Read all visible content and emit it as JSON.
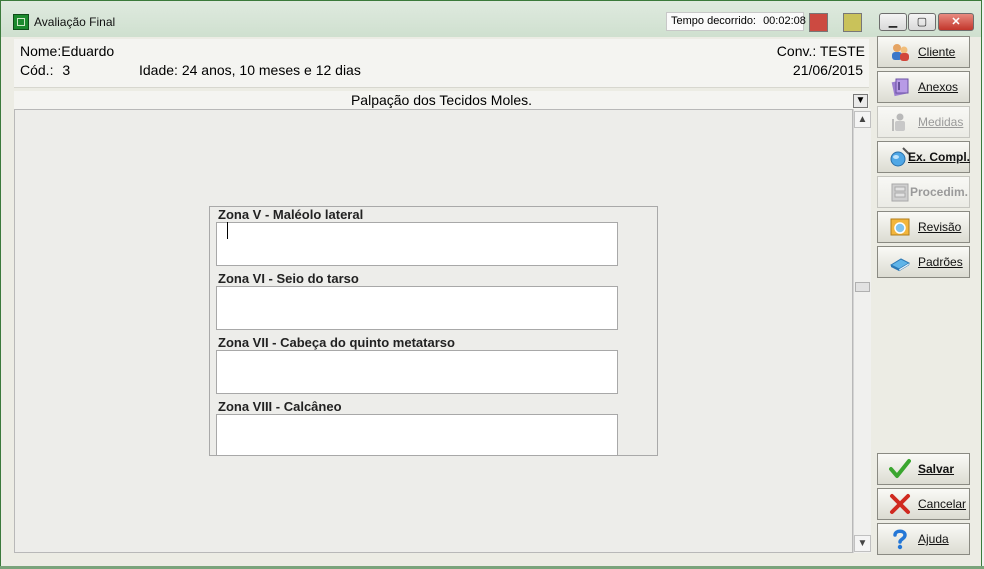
{
  "window": {
    "title": "Avaliação Final"
  },
  "timer": {
    "label": "Tempo decorrido:",
    "value": "00:02:08"
  },
  "window_controls": {
    "minimize": "▁",
    "maximize": "▢",
    "close": "✕"
  },
  "patient": {
    "name_label": "Nome:",
    "name": "Eduardo",
    "code_label": "Cód.:",
    "code": "3",
    "age_label": "Idade:",
    "age": "24 anos, 10 meses e 12 dias",
    "conv_label": "Conv.:",
    "conv": "TESTE",
    "date": "21/06/2015"
  },
  "section": {
    "title": "Palpação dos Tecidos Moles."
  },
  "zones": [
    {
      "label": "Zona V - Maléolo lateral",
      "value": ""
    },
    {
      "label": "Zona VI - Seio do tarso",
      "value": ""
    },
    {
      "label": "Zona VII - Cabeça do quinto metatarso",
      "value": ""
    },
    {
      "label": "Zona VIII - Calcâneo",
      "value": ""
    }
  ],
  "sidebar": {
    "cliente": {
      "label": "Cliente",
      "icon": "people-icon",
      "enabled": true
    },
    "anexos": {
      "label": "Anexos",
      "icon": "attachment-icon",
      "enabled": true
    },
    "medidas": {
      "label": "Medidas",
      "icon": "measure-icon",
      "enabled": false
    },
    "ex_compl": {
      "label": "Ex. Compl.",
      "icon": "flask-icon",
      "enabled": true
    },
    "procedim": {
      "label": "Procedim.",
      "icon": "cabinet-icon",
      "enabled": false
    },
    "revisao": {
      "label": "Revisão",
      "icon": "review-icon",
      "enabled": true
    },
    "padroes": {
      "label": "Padrões",
      "icon": "book-icon",
      "enabled": true
    }
  },
  "actions": {
    "salvar": {
      "label": "Salvar",
      "icon": "check-icon"
    },
    "cancelar": {
      "label": "Cancelar",
      "icon": "x-icon"
    },
    "ajuda": {
      "label": "Ajuda",
      "icon": "help-icon"
    }
  },
  "colors": {
    "accent_red": "#cc4a41",
    "accent_yellow": "#c9c25a",
    "save_green": "#3aa62f",
    "cancel_red": "#d02a20",
    "help_blue": "#2477d6"
  }
}
